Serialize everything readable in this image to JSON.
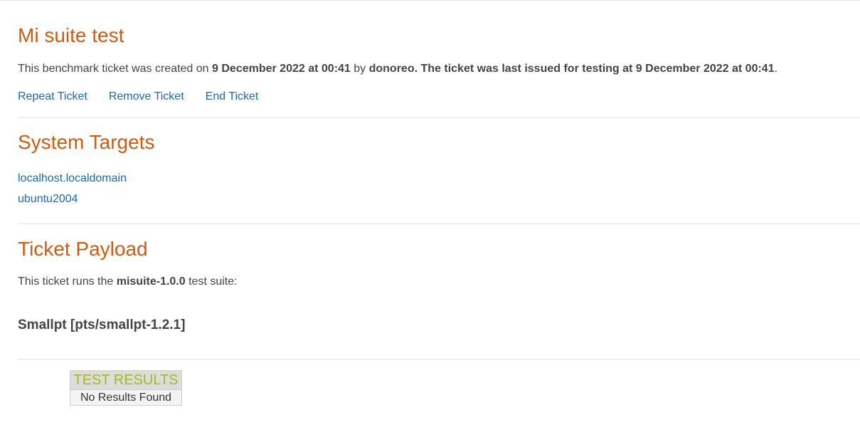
{
  "ticket": {
    "title": "Mi suite test",
    "desc_prefix": "This benchmark ticket was created on ",
    "created_at": "9 December 2022 at 00:41",
    "desc_by": " by ",
    "creator": "donoreo.",
    "issued_text": " The ticket was last issued for testing at ",
    "issued_at": "9 December 2022 at 00:41",
    "desc_suffix": "."
  },
  "actions": {
    "repeat": "Repeat Ticket",
    "remove": "Remove Ticket",
    "end": "End Ticket"
  },
  "targets": {
    "heading": "System Targets",
    "items": [
      "localhost.localdomain",
      "ubuntu2004"
    ]
  },
  "payload": {
    "heading": "Ticket Payload",
    "desc_prefix": "This ticket runs the ",
    "suite": "misuite-1.0.0",
    "desc_suffix": " test suite:",
    "test_name": "Smallpt [pts/smallpt-1.2.1]"
  },
  "results": {
    "heading": "TEST RESULTS",
    "empty": "No Results Found"
  },
  "colors": {
    "heading": "#d35b10",
    "link": "#1a6ab3",
    "results_heading": "#a6b91e"
  }
}
